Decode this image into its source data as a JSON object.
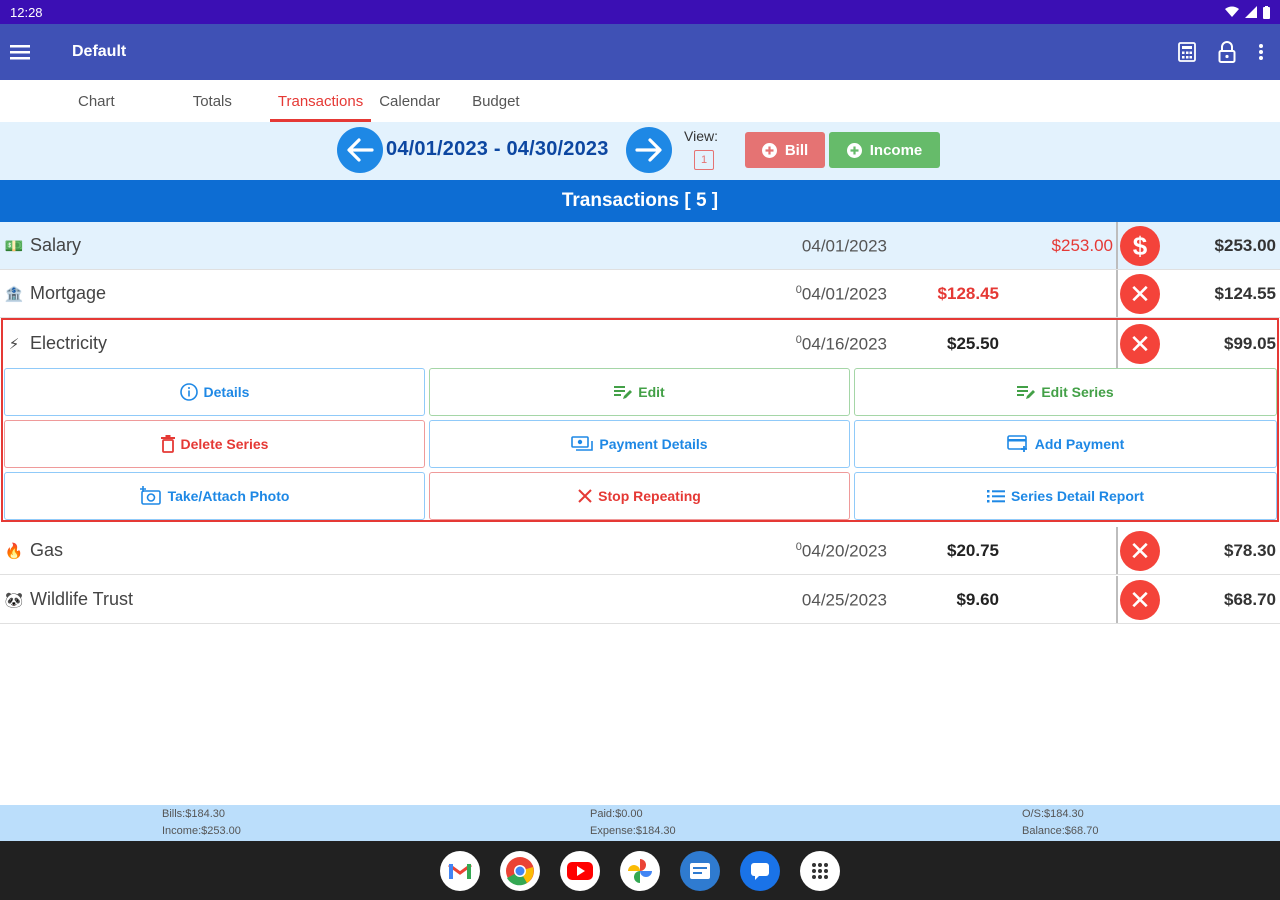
{
  "status_bar": {
    "time": "12:28"
  },
  "app_bar": {
    "title": "Default"
  },
  "tabs": [
    {
      "label": "Chart"
    },
    {
      "label": "Totals"
    },
    {
      "label": "Transactions"
    },
    {
      "label": "Calendar"
    },
    {
      "label": "Budget"
    }
  ],
  "date_nav": {
    "range": "04/01/2023 - 04/30/2023",
    "view_label": "View:",
    "view_value": "1",
    "bill_label": "Bill",
    "income_label": "Income"
  },
  "transactions_header": "Transactions [ 5 ]",
  "rows": [
    {
      "icon": "💵",
      "name": "Salary",
      "date": "04/01/2023",
      "marker": "",
      "amount_expense": "",
      "amount_income": "$253.00",
      "status": "$",
      "balance": "$253.00"
    },
    {
      "icon": "🏦",
      "name": "Mortgage",
      "date": "04/01/2023",
      "marker": "0",
      "amount_expense": "$128.45",
      "amount_income": "",
      "status": "✕",
      "balance": "$124.55"
    },
    {
      "icon": "⚡",
      "name": "Electricity",
      "date": "04/16/2023",
      "marker": "0",
      "amount_expense": "$25.50",
      "amount_income": "",
      "status": "✕",
      "balance": "$99.05"
    },
    {
      "icon": "🔥",
      "name": "Gas",
      "date": "04/20/2023",
      "marker": "0",
      "amount_expense": "$20.75",
      "amount_income": "",
      "status": "✕",
      "balance": "$78.30"
    },
    {
      "icon": "🐼",
      "name": "Wildlife Trust",
      "date": "04/25/2023",
      "marker": "",
      "amount_expense": "$9.60",
      "amount_income": "",
      "status": "✕",
      "balance": "$68.70"
    }
  ],
  "actions": {
    "details": "Details",
    "edit": "Edit",
    "edit_series": "Edit Series",
    "delete_series": "Delete Series",
    "payment_details": "Payment Details",
    "add_payment": "Add Payment",
    "take_photo": "Take/Attach Photo",
    "stop_repeating": "Stop Repeating",
    "series_report": "Series Detail Report"
  },
  "footer": {
    "bills": "Bills:$184.30",
    "income": "Income:$253.00",
    "paid": "Paid:$0.00",
    "expense": "Expense:$184.30",
    "os": "O/S:$184.30",
    "balance": "Balance:$68.70"
  },
  "colors": {
    "status_bar": "#3b0fb4",
    "app_bar": "#3f51b5",
    "tab_active": "#e53935",
    "header": "#0d6dd3",
    "bill_button": "#e57373",
    "income_button": "#66bb6a",
    "expense_text": "#e53935",
    "status_circle": "#f4433a"
  }
}
